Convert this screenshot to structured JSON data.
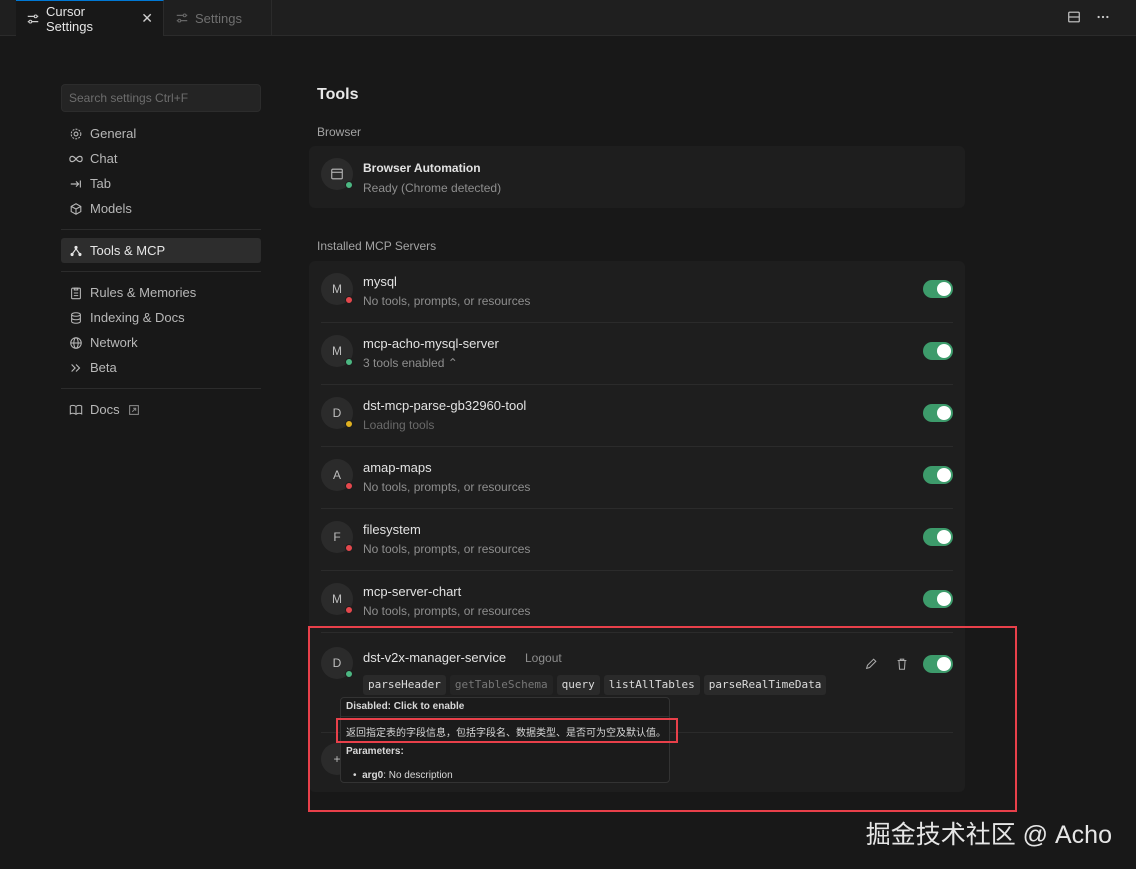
{
  "tabs": [
    {
      "label": "Cursor Settings",
      "active": true
    },
    {
      "label": "Settings",
      "active": false
    }
  ],
  "search": {
    "placeholder": "Search settings Ctrl+F"
  },
  "nav": {
    "group1": [
      {
        "label": "General",
        "icon": "gear-icon"
      },
      {
        "label": "Chat",
        "icon": "infinity-icon"
      },
      {
        "label": "Tab",
        "icon": "tab-arrow-icon"
      },
      {
        "label": "Models",
        "icon": "cube-icon"
      }
    ],
    "group2": [
      {
        "label": "Tools & MCP",
        "icon": "tools-icon",
        "active": true
      }
    ],
    "group3": [
      {
        "label": "Rules & Memories",
        "icon": "clipboard-icon"
      },
      {
        "label": "Indexing & Docs",
        "icon": "database-icon"
      },
      {
        "label": "Network",
        "icon": "globe-icon"
      },
      {
        "label": "Beta",
        "icon": "chevrons-icon"
      }
    ],
    "group4": [
      {
        "label": "Docs",
        "icon": "book-icon"
      }
    ]
  },
  "main": {
    "title": "Tools",
    "browser_section": "Browser",
    "browser": {
      "name": "Browser Automation",
      "status": "Ready (Chrome detected)"
    },
    "servers_section": "Installed MCP Servers",
    "servers": [
      {
        "initial": "M",
        "name": "mysql",
        "status": "No tools, prompts, or resources",
        "dot": "red"
      },
      {
        "initial": "M",
        "name": "mcp-acho-mysql-server",
        "status": "3 tools enabled ⌃",
        "dot": "green"
      },
      {
        "initial": "D",
        "name": "dst-mcp-parse-gb32960-tool",
        "status": "Loading tools",
        "dot": "yellow"
      },
      {
        "initial": "A",
        "name": "amap-maps",
        "status": "No tools, prompts, or resources",
        "dot": "red"
      },
      {
        "initial": "F",
        "name": "filesystem",
        "status": "No tools, prompts, or resources",
        "dot": "red"
      },
      {
        "initial": "M",
        "name": "mcp-server-chart",
        "status": "No tools, prompts, or resources",
        "dot": "red"
      }
    ],
    "expanded": {
      "initial": "D",
      "name": "dst-v2x-manager-service",
      "logout": "Logout",
      "tools": [
        "parseHeader",
        "getTableSchema",
        "query",
        "listAllTables",
        "parseRealTimeData"
      ]
    }
  },
  "tooltip": {
    "header": "Disabled: Click to enable",
    "description": "返回指定表的字段信息，包括字段名、数据类型、是否可为空及默认值。",
    "params_label": "Parameters:",
    "param_name": "arg0",
    "param_desc": ": No description"
  },
  "watermark": "掘金技术社区 @ Acho"
}
